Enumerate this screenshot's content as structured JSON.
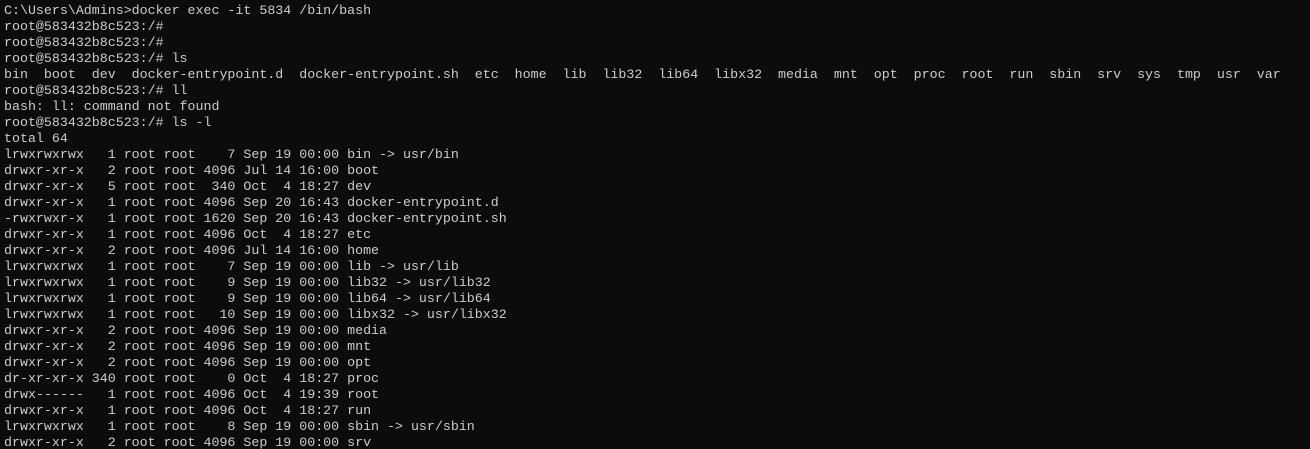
{
  "terminal": {
    "colors": {
      "background": "#0c0c0c",
      "foreground": "#cccccc"
    },
    "lines": [
      "C:\\Users\\Admins>docker exec -it 5834 /bin/bash",
      "root@583432b8c523:/#",
      "root@583432b8c523:/#",
      "root@583432b8c523:/# ls",
      "bin  boot  dev  docker-entrypoint.d  docker-entrypoint.sh  etc  home  lib  lib32  lib64  libx32  media  mnt  opt  proc  root  run  sbin  srv  sys  tmp  usr  var",
      "root@583432b8c523:/# ll",
      "bash: ll: command not found",
      "root@583432b8c523:/# ls -l",
      "total 64",
      "lrwxrwxrwx   1 root root    7 Sep 19 00:00 bin -> usr/bin",
      "drwxr-xr-x   2 root root 4096 Jul 14 16:00 boot",
      "drwxr-xr-x   5 root root  340 Oct  4 18:27 dev",
      "drwxr-xr-x   1 root root 4096 Sep 20 16:43 docker-entrypoint.d",
      "-rwxrwxr-x   1 root root 1620 Sep 20 16:43 docker-entrypoint.sh",
      "drwxr-xr-x   1 root root 4096 Oct  4 18:27 etc",
      "drwxr-xr-x   2 root root 4096 Jul 14 16:00 home",
      "lrwxrwxrwx   1 root root    7 Sep 19 00:00 lib -> usr/lib",
      "lrwxrwxrwx   1 root root    9 Sep 19 00:00 lib32 -> usr/lib32",
      "lrwxrwxrwx   1 root root    9 Sep 19 00:00 lib64 -> usr/lib64",
      "lrwxrwxrwx   1 root root   10 Sep 19 00:00 libx32 -> usr/libx32",
      "drwxr-xr-x   2 root root 4096 Sep 19 00:00 media",
      "drwxr-xr-x   2 root root 4096 Sep 19 00:00 mnt",
      "drwxr-xr-x   2 root root 4096 Sep 19 00:00 opt",
      "dr-xr-xr-x 340 root root    0 Oct  4 18:27 proc",
      "drwx------   1 root root 4096 Oct  4 19:39 root",
      "drwxr-xr-x   1 root root 4096 Oct  4 18:27 run",
      "lrwxrwxrwx   1 root root    8 Sep 19 00:00 sbin -> usr/sbin",
      "drwxr-xr-x   2 root root 4096 Sep 19 00:00 srv"
    ]
  }
}
